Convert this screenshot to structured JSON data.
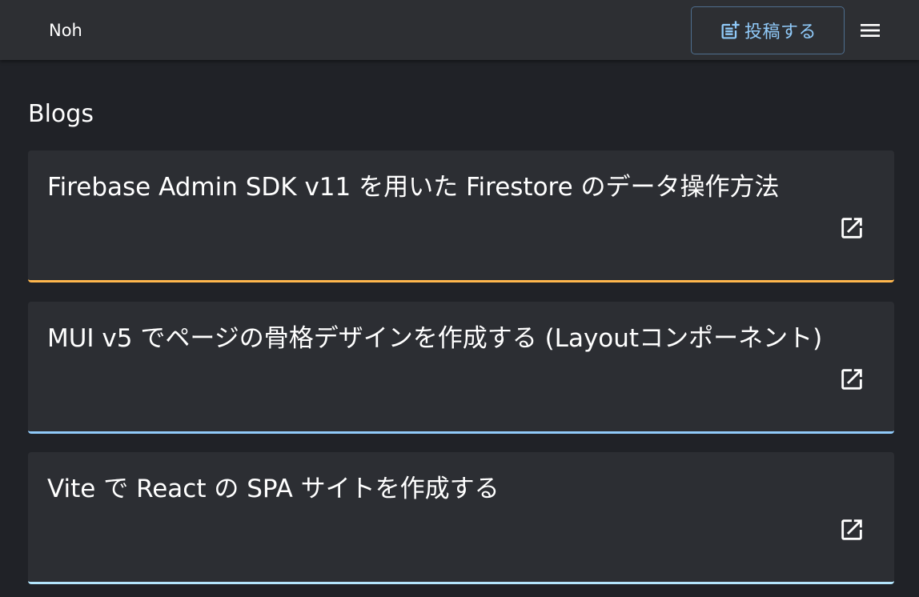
{
  "appbar": {
    "brand": "Noh",
    "post_button_label": "投稿する",
    "post_icon": "post-add-icon",
    "menu_icon": "hamburger-menu-icon"
  },
  "main": {
    "section_title": "Blogs",
    "posts": [
      {
        "title": "Firebase Admin SDK v11 を用いた Firestore のデータ操作方法",
        "accent": "#ffb74d",
        "icon": "open-in-new-icon"
      },
      {
        "title": "MUI v5 でページの骨格デザインを作成する (Layoutコンポーネント)",
        "accent": "#90caf9",
        "icon": "open-in-new-icon"
      },
      {
        "title": "Vite で React の SPA サイトを作成する",
        "accent": "#b3e5fc",
        "icon": "open-in-new-icon"
      }
    ]
  },
  "colors": {
    "background": "#202227",
    "appbar": "#2d2f33",
    "card": "#2c2e33",
    "primary": "#90caf9"
  }
}
